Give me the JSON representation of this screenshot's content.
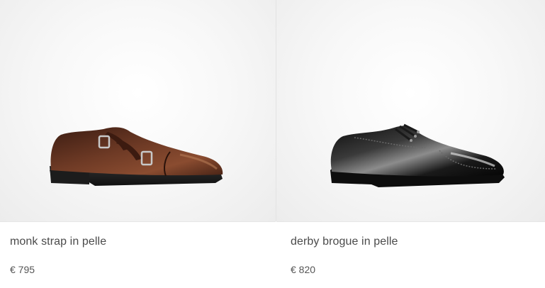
{
  "products": [
    {
      "name": "monk strap in pelle",
      "price": "€ 795",
      "image_icon": "brown-double-monk-strap-shoe",
      "colors": {
        "main": "#5a2f1f",
        "dark": "#2a1510",
        "sole": "#1a1a1a"
      }
    },
    {
      "name": "derby brogue in pelle",
      "price": "€ 820",
      "image_icon": "black-derby-brogue-shoe",
      "colors": {
        "main": "#151515",
        "highlight": "#8a8a8a",
        "sole": "#0a0a0a"
      }
    }
  ]
}
